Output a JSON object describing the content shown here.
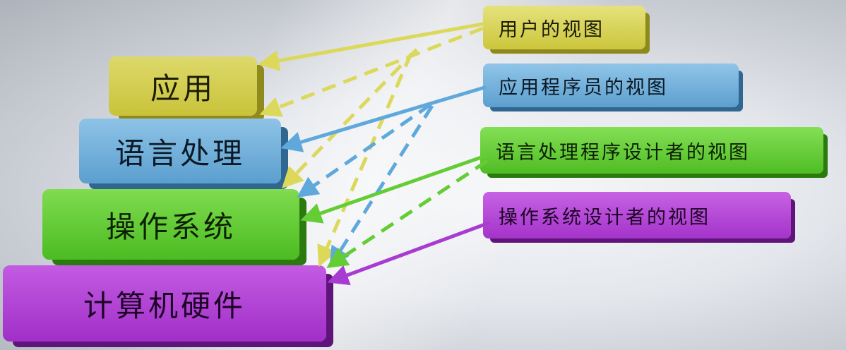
{
  "layers": {
    "application": "应用",
    "language_processing": "语言处理",
    "operating_system": "操作系统",
    "hardware": "计算机硬件"
  },
  "views": {
    "user": "用户的视图",
    "programmer": "应用程序员的视图",
    "language_designer": "语言处理程序设计者的视图",
    "os_designer": "操作系统设计者的视图"
  },
  "colors": {
    "yellow": "#dcd85a",
    "blue": "#5fa8dc",
    "green": "#64cc35",
    "purple": "#a83cd0"
  }
}
